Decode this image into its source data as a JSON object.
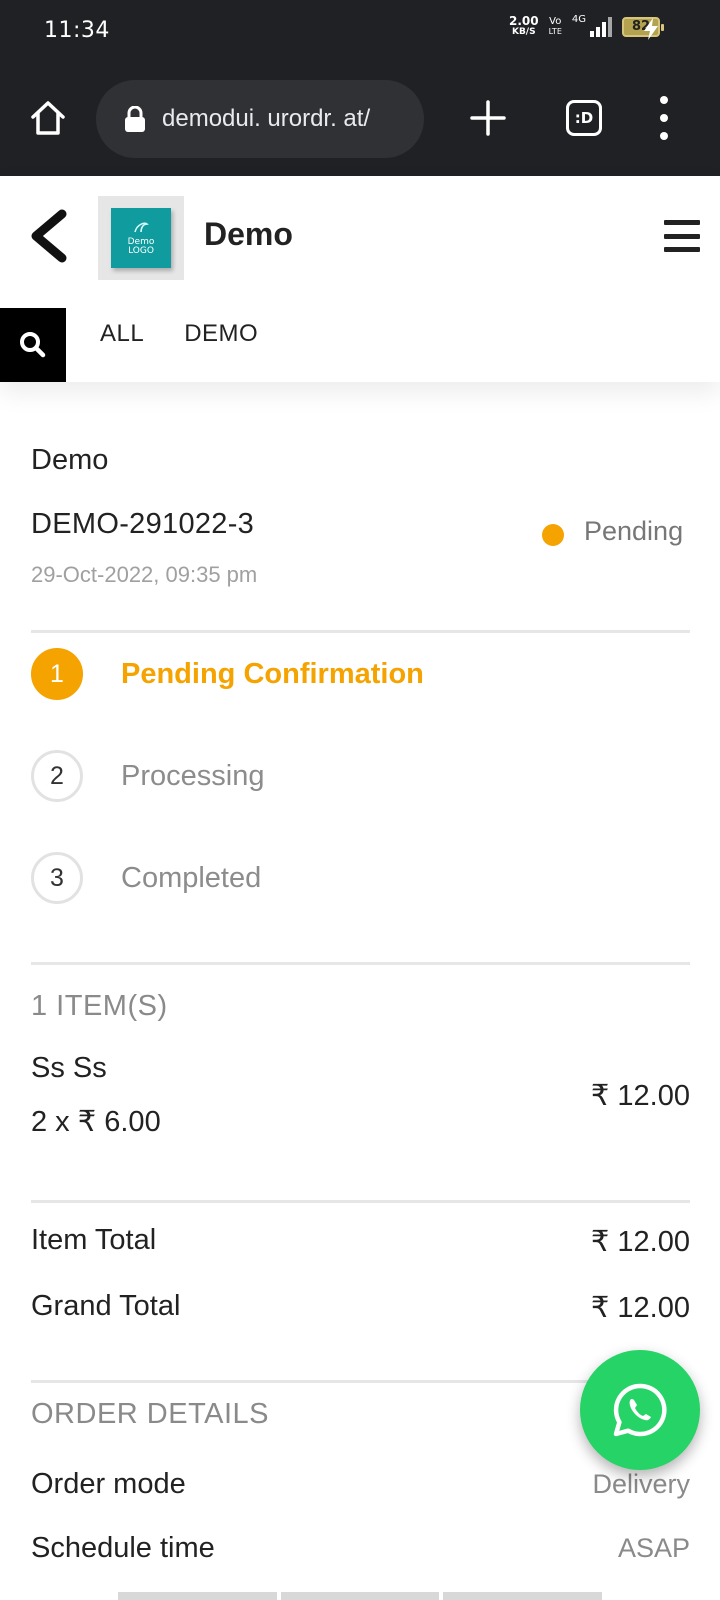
{
  "status_bar": {
    "time": "11:34",
    "net_speed_value": "2.00",
    "net_speed_unit": "KB/S",
    "volte_top": "Vo",
    "volte_bottom": "LTE",
    "network": "4G",
    "battery": "82"
  },
  "browser": {
    "url": "demodui. urordr. at/",
    "tabs_label": ":D",
    "icons": [
      "home-icon",
      "lock-icon",
      "plus-icon",
      "tabs-icon",
      "more-vert-icon"
    ]
  },
  "header": {
    "store_name": "Demo",
    "logo_line1": "Demo",
    "logo_line2": "LOGO",
    "tabs": [
      {
        "label": "ALL"
      },
      {
        "label": "DEMO"
      }
    ],
    "brand_color": "#109c9e"
  },
  "order": {
    "shop": "Demo",
    "id": "DEMO-291022-3",
    "date": "29-Oct-2022, 09:35 pm",
    "status": "Pending",
    "status_color": "#f5a300"
  },
  "steps": [
    {
      "number": "1",
      "label": "Pending Confirmation",
      "active": true
    },
    {
      "number": "2",
      "label": "Processing",
      "active": false
    },
    {
      "number": "3",
      "label": "Completed",
      "active": false
    }
  ],
  "items": {
    "heading": "1 ITEM(S)",
    "list": [
      {
        "name": "Ss Ss",
        "qty_price": "2 x ₹ 6.00",
        "total": "₹ 12.00"
      }
    ]
  },
  "totals": {
    "item_total_label": "Item Total",
    "item_total_value": "₹ 12.00",
    "grand_total_label": "Grand Total",
    "grand_total_value": "₹ 12.00"
  },
  "order_details": {
    "heading": "ORDER DETAILS",
    "rows": [
      {
        "label": "Order mode",
        "value": "Delivery"
      },
      {
        "label": "Schedule time",
        "value": "ASAP"
      }
    ]
  },
  "fab": {
    "icon": "whatsapp-icon",
    "color": "#25d366"
  }
}
